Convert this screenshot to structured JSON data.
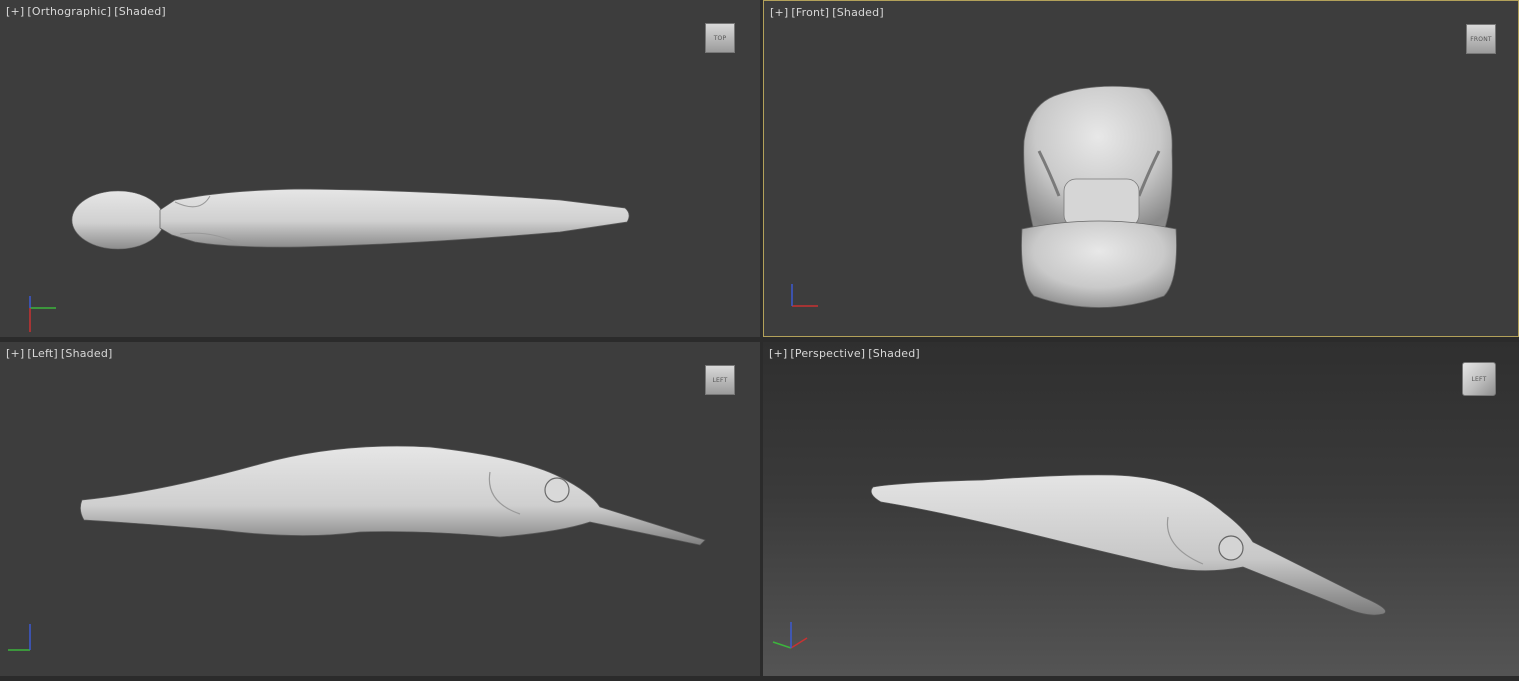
{
  "viewports": {
    "top": {
      "bracket": "[+]",
      "view": "[Orthographic]",
      "mode": "[Shaded]",
      "cube": "TOP"
    },
    "front": {
      "bracket": "[+]",
      "view": "[Front]",
      "mode": "[Shaded]",
      "cube": "FRONT"
    },
    "left": {
      "bracket": "[+]",
      "view": "[Left]",
      "mode": "[Shaded]",
      "cube": "LEFT"
    },
    "persp": {
      "bracket": "[+]",
      "view": "[Perspective]",
      "mode": "[Shaded]",
      "cube": "LEFT"
    }
  },
  "axes": {
    "x": "x",
    "y": "y",
    "z": "z"
  },
  "colors": {
    "viewport_bg": "#3d3d3d",
    "active_border": "#b3a15a",
    "model": "#d2d2d2",
    "axis_x": "#c83232",
    "axis_y": "#3cb43c",
    "axis_z": "#3c5ad2"
  }
}
